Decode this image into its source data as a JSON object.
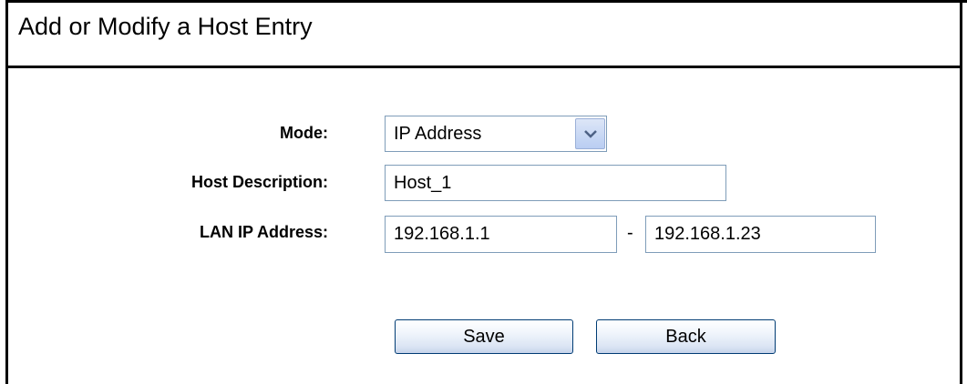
{
  "title": "Add or Modify a Host Entry",
  "form": {
    "mode": {
      "label": "Mode:",
      "selected": "IP Address"
    },
    "host_description": {
      "label": "Host Description:",
      "value": "Host_1"
    },
    "lan_ip": {
      "label": "LAN IP Address:",
      "start": "192.168.1.1",
      "separator": "-",
      "end": "192.168.1.23"
    }
  },
  "buttons": {
    "save": "Save",
    "back": "Back"
  },
  "icons": {
    "select_arrow": "chevron-down-icon"
  }
}
